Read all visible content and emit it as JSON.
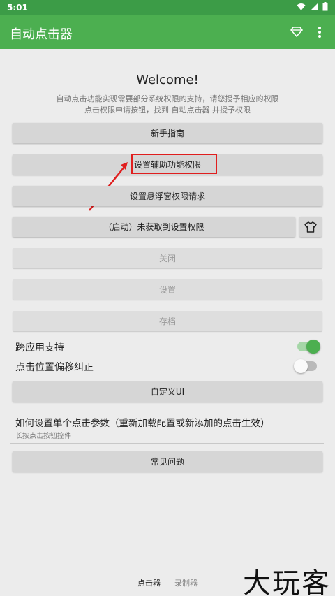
{
  "status_bar": {
    "time": "5:01",
    "icons": [
      "wifi-icon",
      "signal-icon",
      "battery-icon"
    ]
  },
  "app_bar": {
    "title": "自动点击器",
    "icons": [
      "diamond-icon",
      "more-vert-icon"
    ]
  },
  "intro": {
    "welcome": "Welcome!",
    "desc_line1": "自动点击功能实现需要部分系统权限的支持，请您授予相应的权限",
    "desc_line2": "点击权限申请按钮，找到 自动点击器 并授予权限"
  },
  "buttons": {
    "guide": "新手指南",
    "accessibility": "设置辅助功能权限",
    "overlay": "设置悬浮窗权限请求",
    "start": "（启动）未获取到设置权限",
    "close": "关闭",
    "settings": "设置",
    "archive": "存档",
    "custom_ui": "自定义UI",
    "faq": "常见问题"
  },
  "toggles": {
    "cross_app": {
      "label": "跨应用支持",
      "on": true
    },
    "offset_fix": {
      "label": "点击位置偏移纠正",
      "on": false
    }
  },
  "help": {
    "title": "如何设置单个点击参数（重新加载配置或新添加的点击生效）",
    "subtitle": "长按点击按钮控件"
  },
  "bottom_tabs": [
    "点击器",
    "录制器"
  ],
  "watermark": "大玩客",
  "colors": {
    "primary": "#4caf50",
    "status": "#3c9c47",
    "highlight": "#e01e1e"
  }
}
